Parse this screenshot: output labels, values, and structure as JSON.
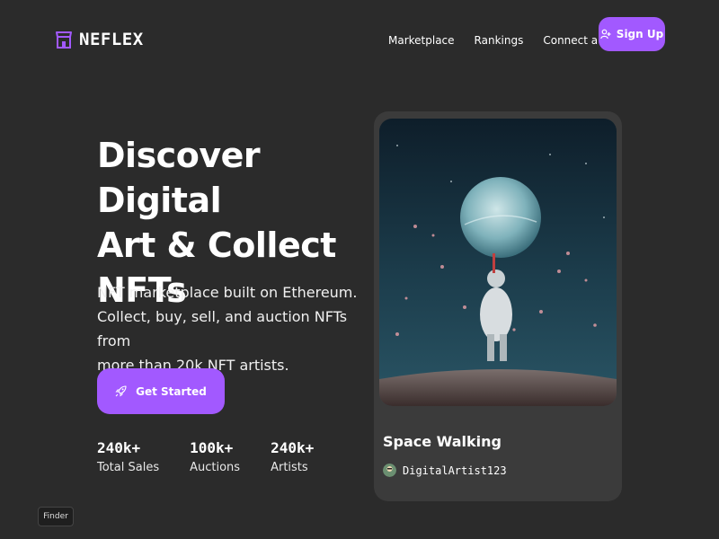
{
  "nav": {
    "logo_text": "NEFLEX",
    "links": [
      "Marketplace",
      "Rankings",
      "Connect a wallet"
    ],
    "signup_label": "Sign Up"
  },
  "hero": {
    "title_lines": [
      "Discover Digital",
      "Art & Collect",
      "NFTs"
    ],
    "subtitle_lines": [
      "NFT marketplace built on Ethereum.",
      "Collect, buy, sell, and auction NFTs from",
      "more than 20k NFT artists."
    ],
    "cta_label": "Get Started",
    "stats": [
      {
        "value": "240k+",
        "label": "Total Sales"
      },
      {
        "value": "100k+",
        "label": "Auctions"
      },
      {
        "value": "240k+",
        "label": "Artists"
      }
    ]
  },
  "card": {
    "title": "Space Walking",
    "artist": "DigitalArtist123"
  },
  "finder_label": "Finder",
  "colors": {
    "background": "#2b2b2b",
    "accent": "#a259ff",
    "card": "#3b3b3b"
  },
  "icons": {
    "logo": "storefront-icon",
    "signup": "user-plus-icon",
    "cta": "rocket-icon"
  }
}
